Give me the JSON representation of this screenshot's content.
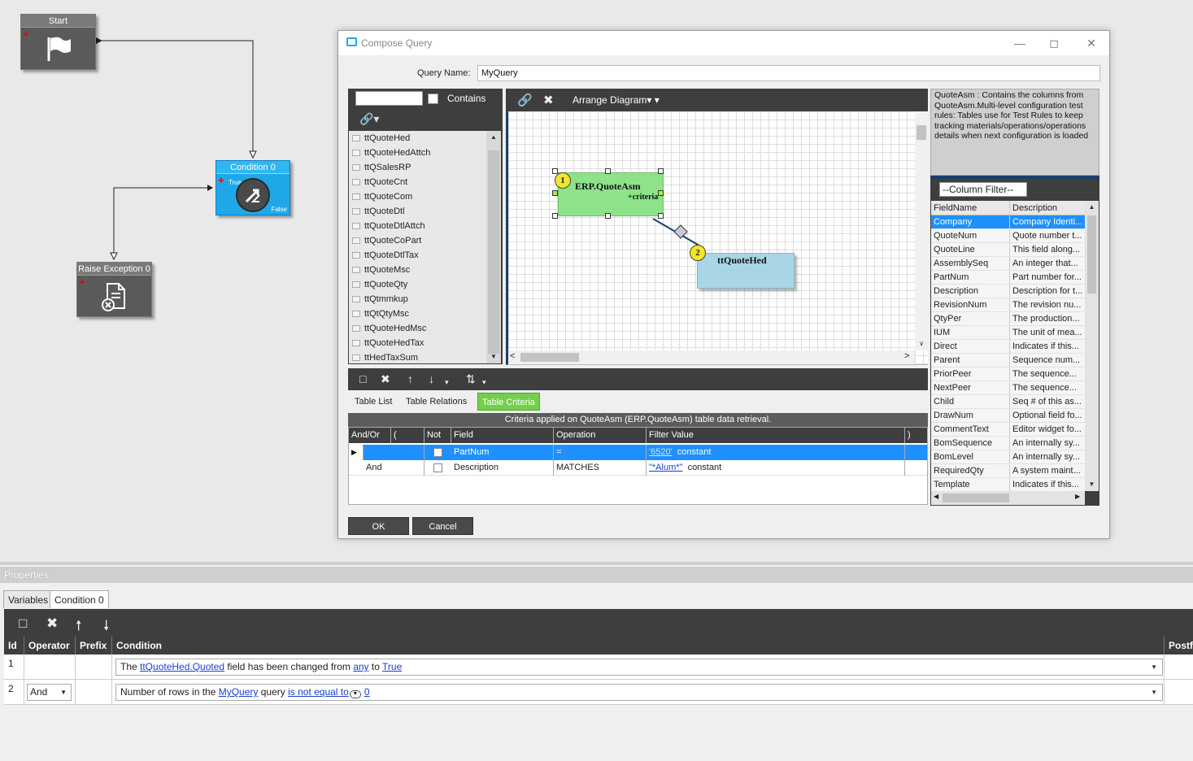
{
  "workflow": {
    "start_title": "Start",
    "condition_title": "Condition 0",
    "condition_true": "True",
    "condition_false": "False",
    "exception_title": "Raise Exception 0"
  },
  "dialog": {
    "title": "Compose Query",
    "query_name_label": "Query Name:",
    "query_name_value": "MyQuery",
    "contains_label": "Contains",
    "arrange_label": "Arrange Diagram",
    "tables": [
      "ttQuoteHed",
      "ttQuoteHedAttch",
      "ttQSalesRP",
      "ttQuoteCnt",
      "ttQuoteCom",
      "ttQuoteDtl",
      "ttQuoteDtlAttch",
      "ttQuoteCoPart",
      "ttQuoteDtlTax",
      "ttQuoteMsc",
      "ttQuoteQty",
      "ttQtmmkup",
      "ttQtQtyMsc",
      "ttQuoteHedMsc",
      "ttQuoteHedTax",
      "ttHedTaxSum"
    ],
    "diagram": {
      "table1_badge": "1",
      "table1_name": "ERP.QuoteAsm",
      "table1_sub": "+criteria",
      "table2_badge": "2",
      "table2_name": "ttQuoteHed"
    },
    "info_text": "QuoteAsm : Contains the columns from QuoteAsm.Multi-level configuration test rules: Tables use for Test Rules to keep tracking materials/operations/operations details when next configuration is loaded",
    "column_filter": "--Column Filter--",
    "column_headers": [
      "FieldName",
      "Description"
    ],
    "columns": [
      {
        "field": "Company",
        "desc": "Company Identi..."
      },
      {
        "field": "QuoteNum",
        "desc": "Quote number t..."
      },
      {
        "field": "QuoteLine",
        "desc": "This field along..."
      },
      {
        "field": "AssemblySeq",
        "desc": "An integer that..."
      },
      {
        "field": "PartNum",
        "desc": "Part number for..."
      },
      {
        "field": "Description",
        "desc": "Description for t..."
      },
      {
        "field": "RevisionNum",
        "desc": "The revision nu..."
      },
      {
        "field": "QtyPer",
        "desc": "The production..."
      },
      {
        "field": "IUM",
        "desc": "The unit of mea..."
      },
      {
        "field": "Direct",
        "desc": "Indicates if this..."
      },
      {
        "field": "Parent",
        "desc": "Sequence num..."
      },
      {
        "field": "PriorPeer",
        "desc": "The sequence..."
      },
      {
        "field": "NextPeer",
        "desc": "The sequence..."
      },
      {
        "field": "Child",
        "desc": "Seq # of this as..."
      },
      {
        "field": "DrawNum",
        "desc": "Optional field fo..."
      },
      {
        "field": "CommentText",
        "desc": "Editor widget fo..."
      },
      {
        "field": "BomSequence",
        "desc": "An internally sy..."
      },
      {
        "field": "BomLevel",
        "desc": "An internally sy..."
      },
      {
        "field": "RequiredQty",
        "desc": "A system maint..."
      },
      {
        "field": "Template",
        "desc": "Indicates if this..."
      }
    ],
    "tabs": [
      "Table List",
      "Table Relations",
      "Table Criteria"
    ],
    "criteria_caption": "Criteria applied on QuoteAsm (ERP.QuoteAsm)  table data retrieval.",
    "criteria_headers": [
      "And/Or",
      "(",
      "Not",
      "Field",
      "Operation",
      "Filter Value",
      ")"
    ],
    "criteria_rows": [
      {
        "andor": "",
        "field": "PartNum",
        "operation": "=",
        "value": "'6520'",
        "value_type": "constant"
      },
      {
        "andor": "And",
        "field": "Description",
        "operation": "MATCHES",
        "value": "\"*Alum*\"",
        "value_type": "constant"
      }
    ],
    "ok_label": "OK",
    "cancel_label": "Cancel"
  },
  "properties": {
    "title": "Properties",
    "tabs": [
      "Variables",
      "Condition 0"
    ],
    "headers": [
      "Id",
      "Operator",
      "Prefix",
      "Condition",
      "Postf"
    ],
    "rows": [
      {
        "id": "1",
        "operator": "",
        "c1": "The ",
        "c1_link1": "ttQuoteHed.Quoted",
        "c1_mid": " field has been changed from ",
        "c1_link2": "any",
        "c1_to": " to ",
        "c1_link3": "True"
      },
      {
        "id": "2",
        "operator": "And",
        "c2": "Number of rows in the ",
        "c2_link1": "MyQuery",
        "c2_mid": " query ",
        "c2_link2": "is not equal to",
        "c2_link3": "0"
      }
    ]
  }
}
